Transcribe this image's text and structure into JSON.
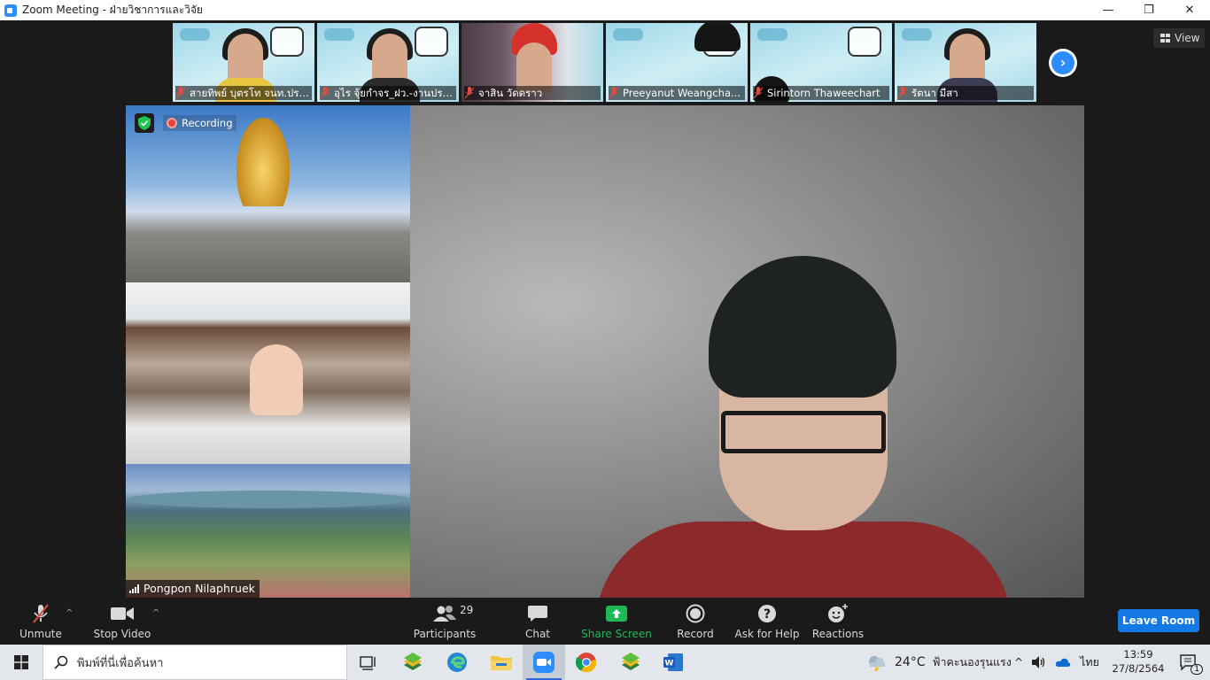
{
  "window": {
    "title": "Zoom Meeting - ฝ่ายวิชาการและวิจัย",
    "controls": [
      "—",
      "❐",
      "✕"
    ]
  },
  "gallery": {
    "participants": [
      {
        "name": "สายทิพย์  บุตรโท  จนท.ประ..."
      },
      {
        "name": "อุไร จุ้ยกำจร_ฝว.-งานประ..."
      },
      {
        "name": "จาสิน วัดดราว"
      },
      {
        "name": "Preeyanut Weangcha..."
      },
      {
        "name": "Sirintorn Thaweechart"
      },
      {
        "name": "รัตนา มีสา"
      }
    ],
    "next_icon": "chevron-right-icon",
    "view_label": "View"
  },
  "main_video": {
    "recording_label": "Recording",
    "speaker_name": "Pongpon Nilaphruek"
  },
  "toolbar": {
    "unmute": "Unmute",
    "stop_video": "Stop Video",
    "participants": "Participants",
    "participants_count": "29",
    "chat": "Chat",
    "share_screen": "Share Screen",
    "record": "Record",
    "ask_for_help": "Ask for Help",
    "reactions": "Reactions",
    "leave_room": "Leave Room",
    "share_color": "#1db954",
    "leave_color": "#1479e5"
  },
  "taskbar": {
    "search_placeholder": "พิมพ์ที่นี่เพื่อค้นหา",
    "weather_temp": "24°C",
    "weather_desc": "ฟ้าคะนองรุนแรง",
    "language": "ไทย",
    "time": "13:59",
    "date": "27/8/2564",
    "notification_count": "1"
  }
}
